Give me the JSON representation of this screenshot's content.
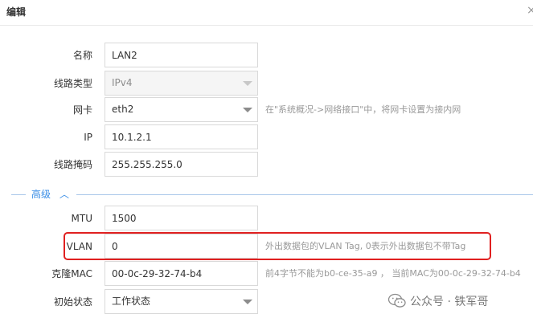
{
  "dialog": {
    "title": "编辑",
    "close_icon": "×"
  },
  "form": {
    "name": {
      "label": "名称",
      "value": "LAN2"
    },
    "line_type": {
      "label": "线路类型",
      "value": "IPv4"
    },
    "nic": {
      "label": "网卡",
      "value": "eth2",
      "hint": "在\"系统概况->网络接口\"中，将网卡设置为接内网"
    },
    "ip": {
      "label": "IP",
      "value": "10.1.2.1"
    },
    "mask": {
      "label": "线路掩码",
      "value": "255.255.255.0"
    }
  },
  "advanced": {
    "title": "高级",
    "chevron": "︿",
    "mtu": {
      "label": "MTU",
      "value": "1500"
    },
    "vlan": {
      "label": "VLAN",
      "value": "0",
      "hint": "外出数据包的VLAN Tag, 0表示外出数据包不带Tag"
    },
    "clone_mac": {
      "label": "克隆MAC",
      "value": "00-0c-29-32-74-b4",
      "hint": "前4字节不能为b0-ce-35-a9 ， 当前MAC为00-0c-29-32-74-b4"
    },
    "initial_state": {
      "label": "初始状态",
      "value": "工作状态"
    }
  },
  "watermark": {
    "text": "公众号 · 铁军哥",
    "icon": "wechat-icon"
  },
  "colors": {
    "accent": "#3a8ee6",
    "highlight_border": "#e02020",
    "hint_text": "#999999"
  }
}
